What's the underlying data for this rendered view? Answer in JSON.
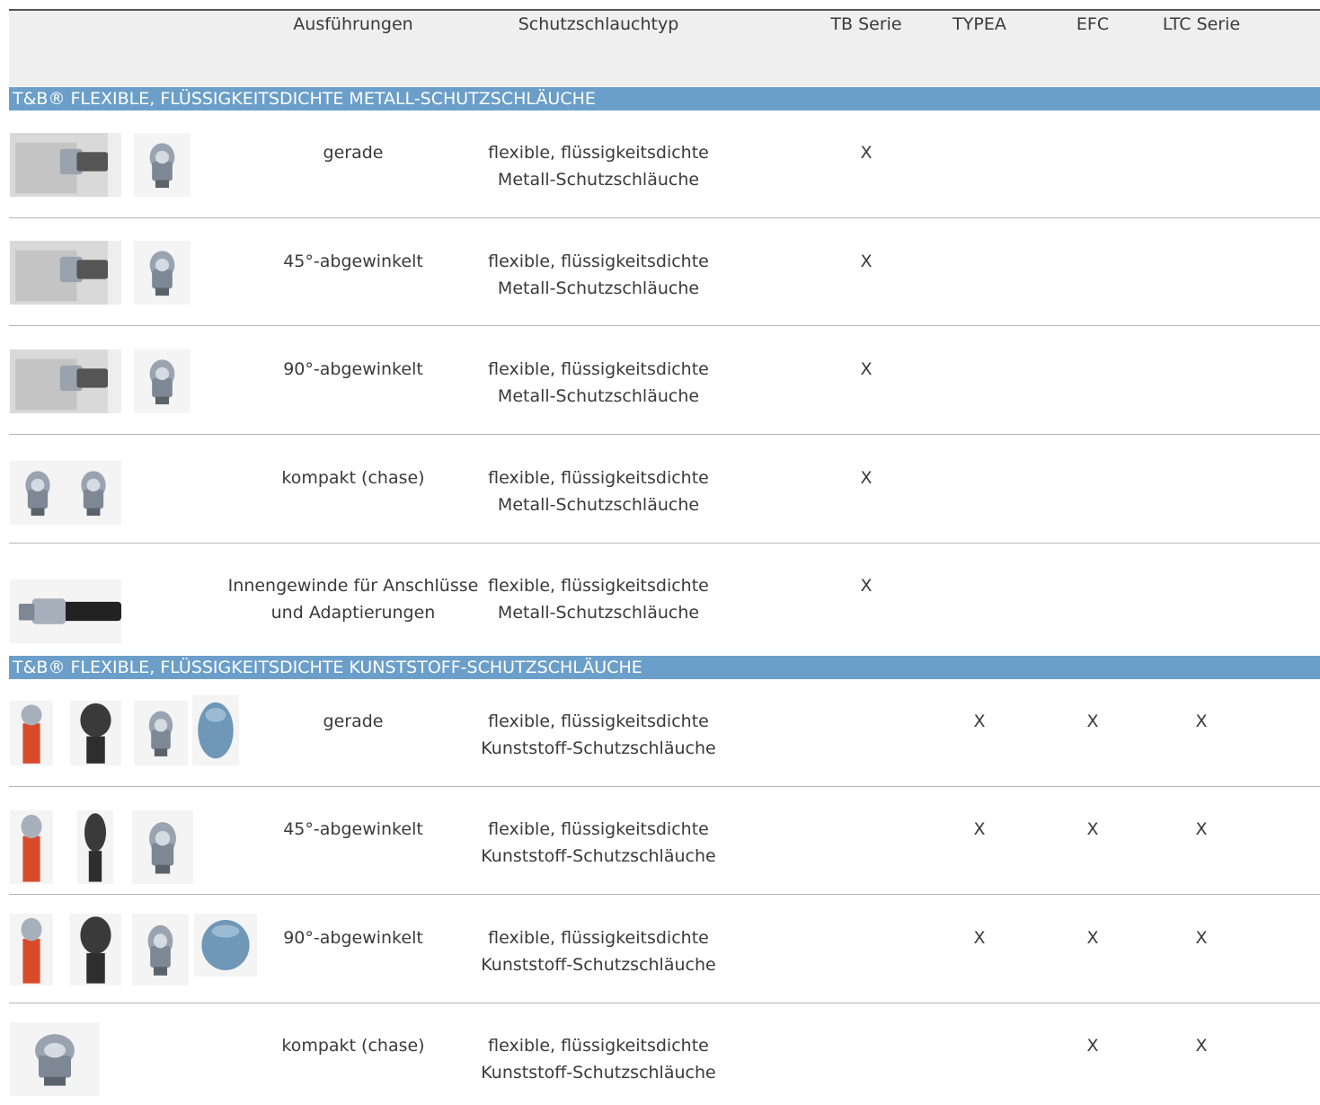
{
  "header": {
    "variants": "Ausführungen",
    "conduit_type": "Schutzschlauchtyp",
    "series": [
      "TB Serie",
      "TYPEA",
      "EFC",
      "LTC Serie"
    ]
  },
  "sections": [
    {
      "title": "T&B®  FLEXIBLE, FLÜSSIGKEITSDICHTE METALL-SCHUTZSCHLÄUCHE",
      "rows": [
        {
          "variant": [
            "gerade",
            ""
          ],
          "type": [
            "flexible, flüssigkeitsdichte",
            "Metall-Schutzschläuche"
          ],
          "marks": [
            "X",
            "",
            "",
            ""
          ]
        },
        {
          "variant": [
            "45°-abgewinkelt",
            ""
          ],
          "type": [
            "flexible, flüssigkeitsdichte",
            "Metall-Schutzschläuche"
          ],
          "marks": [
            "X",
            "",
            "",
            ""
          ]
        },
        {
          "variant": [
            "90°-abgewinkelt",
            ""
          ],
          "type": [
            "flexible, flüssigkeitsdichte",
            "Metall-Schutzschläuche"
          ],
          "marks": [
            "X",
            "",
            "",
            ""
          ]
        },
        {
          "variant": [
            "kompakt (chase)",
            ""
          ],
          "type": [
            "flexible, flüssigkeitsdichte",
            "Metall-Schutzschläuche"
          ],
          "marks": [
            "X",
            "",
            "",
            ""
          ]
        },
        {
          "variant": [
            "Innengewinde für Anschlüsse",
            "und Adaptierungen"
          ],
          "type": [
            "flexible, flüssigkeitsdichte",
            "Metall-Schutzschläuche"
          ],
          "marks": [
            "X",
            "",
            "",
            ""
          ]
        }
      ]
    },
    {
      "title": "T&B® FLEXIBLE, FLÜSSIGKEITSDICHTE KUNSTSTOFF-SCHUTZSCHLÄUCHE",
      "rows": [
        {
          "variant": [
            "gerade",
            ""
          ],
          "type": [
            "flexible, flüssigkeitsdichte",
            "Kunststoff-Schutzschläuche"
          ],
          "marks": [
            "",
            "X",
            "X",
            "X"
          ]
        },
        {
          "variant": [
            "45°-abgewinkelt",
            ""
          ],
          "type": [
            "flexible, flüssigkeitsdichte",
            "Kunststoff-Schutzschläuche"
          ],
          "marks": [
            "",
            "X",
            "X",
            "X"
          ]
        },
        {
          "variant": [
            "90°-abgewinkelt",
            ""
          ],
          "type": [
            "flexible, flüssigkeitsdichte",
            "Kunststoff-Schutzschläuche"
          ],
          "marks": [
            "",
            "X",
            "X",
            "X"
          ]
        },
        {
          "variant": [
            "kompakt (chase)",
            ""
          ],
          "type": [
            "flexible, flüssigkeitsdichte",
            "Kunststoff-Schutzschläuche"
          ],
          "marks": [
            "",
            "",
            "X",
            "X"
          ]
        }
      ]
    }
  ],
  "icons": {
    "fitting_metal": "metal-fitting-icon",
    "fitting_plastic_red": "red-conduit-fitting-icon",
    "fitting_plastic_black": "black-conduit-fitting-icon",
    "fitting_plastic_blue": "blue-conduit-fitting-icon"
  },
  "colors": {
    "section_bar": "#6b9fca",
    "header_bg": "#efefef",
    "row_separator": "#b5b5b5"
  }
}
